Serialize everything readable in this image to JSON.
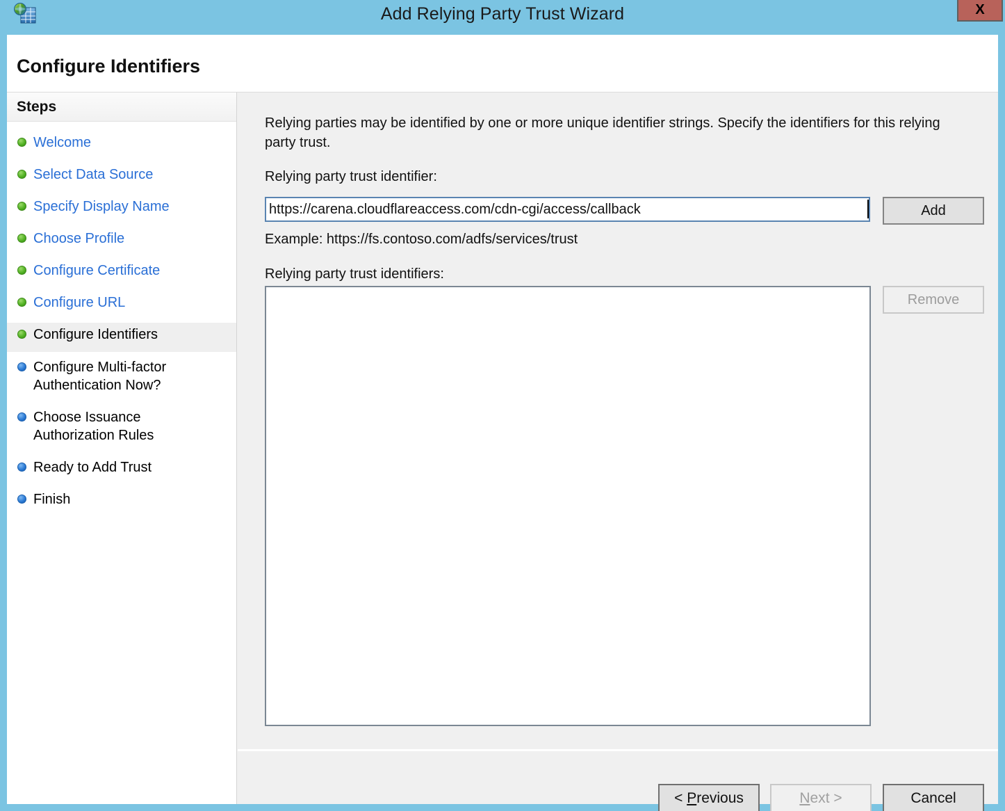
{
  "window": {
    "title": "Add Relying Party Trust Wizard",
    "app_icon": "adfs-relying-party-icon",
    "close_label": "X",
    "titlebar_color": "#7BC4E2",
    "body_color": "#F0F0F0"
  },
  "page": {
    "title": "Configure Identifiers"
  },
  "sidebar": {
    "header": "Steps",
    "items": [
      {
        "label": "Welcome",
        "state": "done"
      },
      {
        "label": "Select Data Source",
        "state": "done"
      },
      {
        "label": "Specify Display Name",
        "state": "done"
      },
      {
        "label": "Choose Profile",
        "state": "done"
      },
      {
        "label": "Configure Certificate",
        "state": "done"
      },
      {
        "label": "Configure URL",
        "state": "done"
      },
      {
        "label": "Configure Identifiers",
        "state": "current"
      },
      {
        "label": "Configure Multi-factor Authentication Now?",
        "state": "todo"
      },
      {
        "label": "Choose Issuance Authorization Rules",
        "state": "todo"
      },
      {
        "label": "Ready to Add Trust",
        "state": "todo"
      },
      {
        "label": "Finish",
        "state": "todo"
      }
    ],
    "bullet_done_color": "#54B225",
    "bullet_todo_color": "#2E7CD6",
    "link_color": "#2A6FD6"
  },
  "main": {
    "intro": "Relying parties may be identified by one or more unique identifier strings. Specify the identifiers for this relying party trust.",
    "identifier_label": "Relying party trust identifier:",
    "identifier_value": "https://carena.cloudflareaccess.com/cdn-cgi/access/callback",
    "identifier_placeholder": "",
    "example_text": "Example: https://fs.contoso.com/adfs/services/trust",
    "identifiers_list_label": "Relying party trust identifiers:",
    "identifiers_list": [],
    "add_label": "Add",
    "remove_label": "Remove"
  },
  "footer": {
    "previous_prefix": "< ",
    "previous_accel": "P",
    "previous_rest": "revious",
    "next_accel": "N",
    "next_rest": "ext >",
    "cancel_label": "Cancel"
  }
}
